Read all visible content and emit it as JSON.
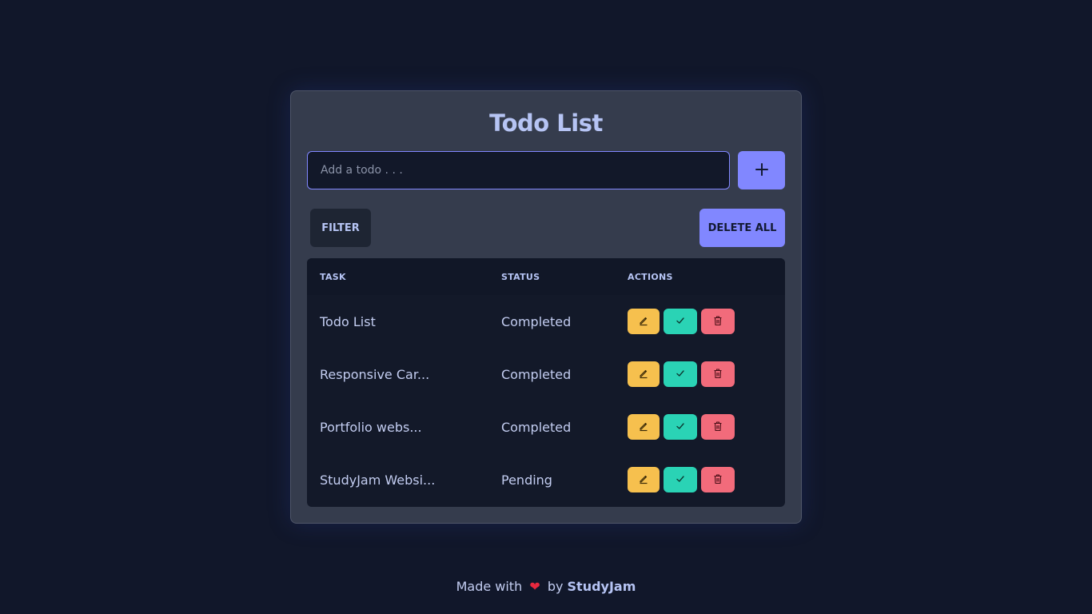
{
  "app": {
    "title": "Todo List"
  },
  "input": {
    "placeholder": "Add a todo . . .",
    "value": ""
  },
  "buttons": {
    "add_icon": "plus-icon",
    "filter_label": "FILTER",
    "delete_all_label": "DELETE ALL"
  },
  "table": {
    "headers": {
      "task": "TASK",
      "status": "STATUS",
      "actions": "ACTIONS"
    },
    "rows": [
      {
        "task": "Todo List",
        "status": "Completed"
      },
      {
        "task": "Responsive Car...",
        "status": "Completed"
      },
      {
        "task": "Portfolio webs...",
        "status": "Completed"
      },
      {
        "task": "StudyJam Websi...",
        "status": "Pending"
      }
    ],
    "action_icons": [
      "pencil-icon",
      "check-icon",
      "trash-icon"
    ]
  },
  "footer": {
    "prefix": "Made with",
    "heart": "❤",
    "middle": "by",
    "brand": "StudyJam"
  },
  "colors": {
    "background": "#11172a",
    "card": "#353c4d",
    "accent": "#8187ff",
    "edit": "#f6c04e",
    "complete": "#2ad3b5",
    "delete": "#f26b7b"
  }
}
